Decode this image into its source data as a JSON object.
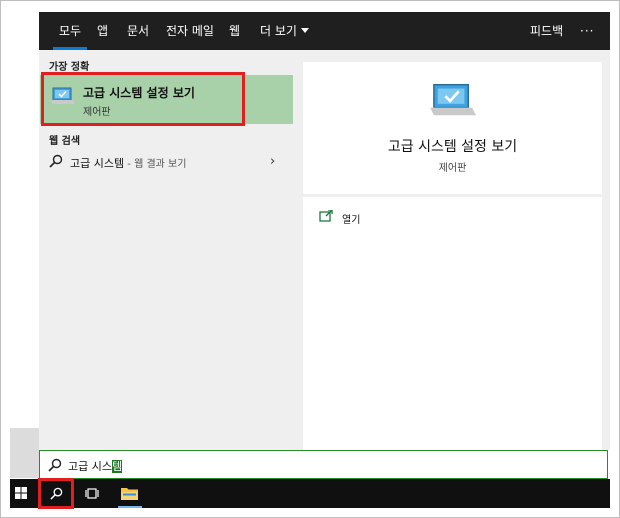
{
  "nav": {
    "tabs": [
      "모두",
      "앱",
      "문서",
      "전자 메일",
      "웹",
      "더 보기"
    ],
    "active_tab": "모두",
    "feedback": "피드백",
    "more": "···"
  },
  "left": {
    "best_match_header": "가장 정확",
    "best_match": {
      "title": "고급 시스템 설정 보기",
      "subtitle": "제어판",
      "icon": "computer-check-icon"
    },
    "web_header": "웹 검색",
    "web_result": {
      "label": "고급 시스템",
      "suffix": " - 웹 결과 보기",
      "icon": "search-icon",
      "arrow": "›"
    }
  },
  "right": {
    "title": "고급 시스템 설정 보기",
    "subtitle": "제어판",
    "icon": "computer-check-icon",
    "actions": [
      {
        "label": "열기",
        "icon": "open-window-icon"
      }
    ]
  },
  "search": {
    "typed": "고급 시스",
    "completion": "템",
    "icon": "search-icon"
  },
  "taskbar": {
    "items": [
      "windows-start-icon",
      "search-icon",
      "task-view-icon",
      "file-explorer-icon"
    ]
  },
  "colors": {
    "nav_bg": "#1f1f1f",
    "pane_bg": "#efefef",
    "best_match_bg": "#a9d1a9",
    "highlight_box": "#e02020",
    "accent_blue": "#0a7cd4",
    "search_border": "#2a8a2a",
    "taskbar_bg": "#101010"
  }
}
